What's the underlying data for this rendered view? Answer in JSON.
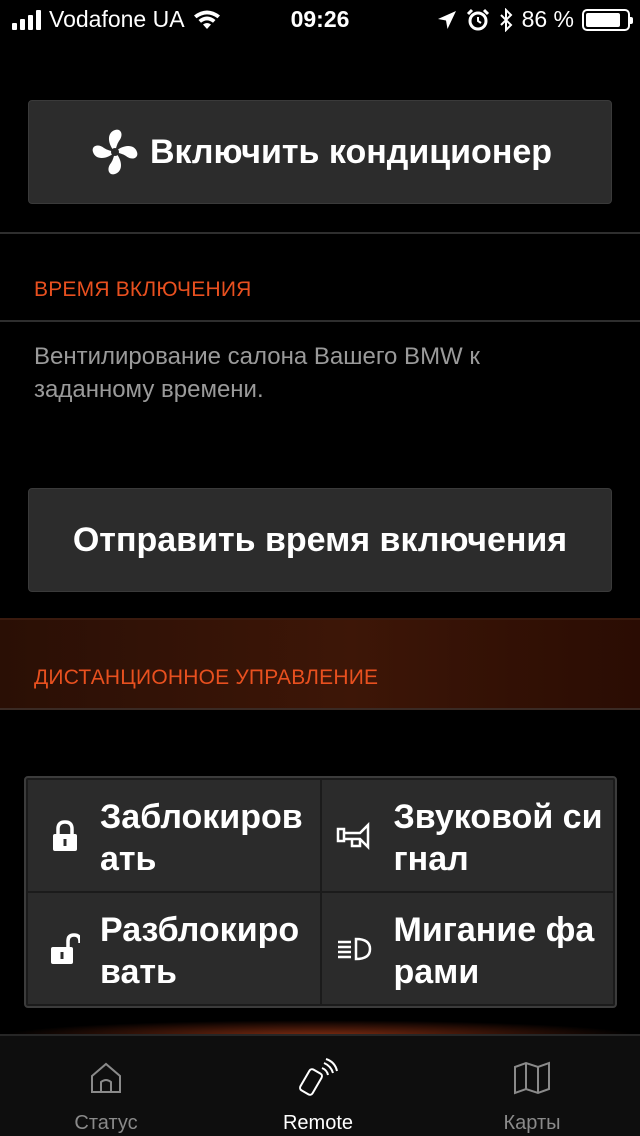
{
  "status_bar": {
    "carrier": "Vodafone UA",
    "time": "09:26",
    "battery_percent": "86 %",
    "battery_level": 0.86,
    "icons": [
      "signal-icon",
      "wifi-icon",
      "location-icon",
      "alarm-icon",
      "bluetooth-icon",
      "battery-icon"
    ]
  },
  "climate": {
    "ac_button_label": "Включить кондиционер",
    "ac_icon": "fan-icon"
  },
  "timer_section": {
    "title": "ВРЕМЯ ВКЛЮЧЕНИЯ",
    "description": "Вентилирование салона Вашего BMW к заданному времени.",
    "send_button_label": "Отправить время включения"
  },
  "remote_section": {
    "title": "ДИСТАНЦИОННОЕ УПРАВЛЕНИЕ",
    "actions": [
      {
        "label": "Заблокировать",
        "icon": "lock-icon"
      },
      {
        "label": "Звуковой сигнал",
        "icon": "horn-icon"
      },
      {
        "label": "Разблокировать",
        "icon": "unlock-icon"
      },
      {
        "label": "Мигание фарами",
        "icon": "headlight-icon"
      }
    ]
  },
  "tab_bar": {
    "tabs": [
      {
        "label": "Статус",
        "icon": "home-icon",
        "active": false
      },
      {
        "label": "Remote",
        "icon": "remote-key-icon",
        "active": true
      },
      {
        "label": "Карты",
        "icon": "map-icon",
        "active": false
      }
    ]
  },
  "colors": {
    "accent": "#e8501f",
    "button_bg": "#2c2c2c",
    "description_text": "#9a9a9a"
  }
}
